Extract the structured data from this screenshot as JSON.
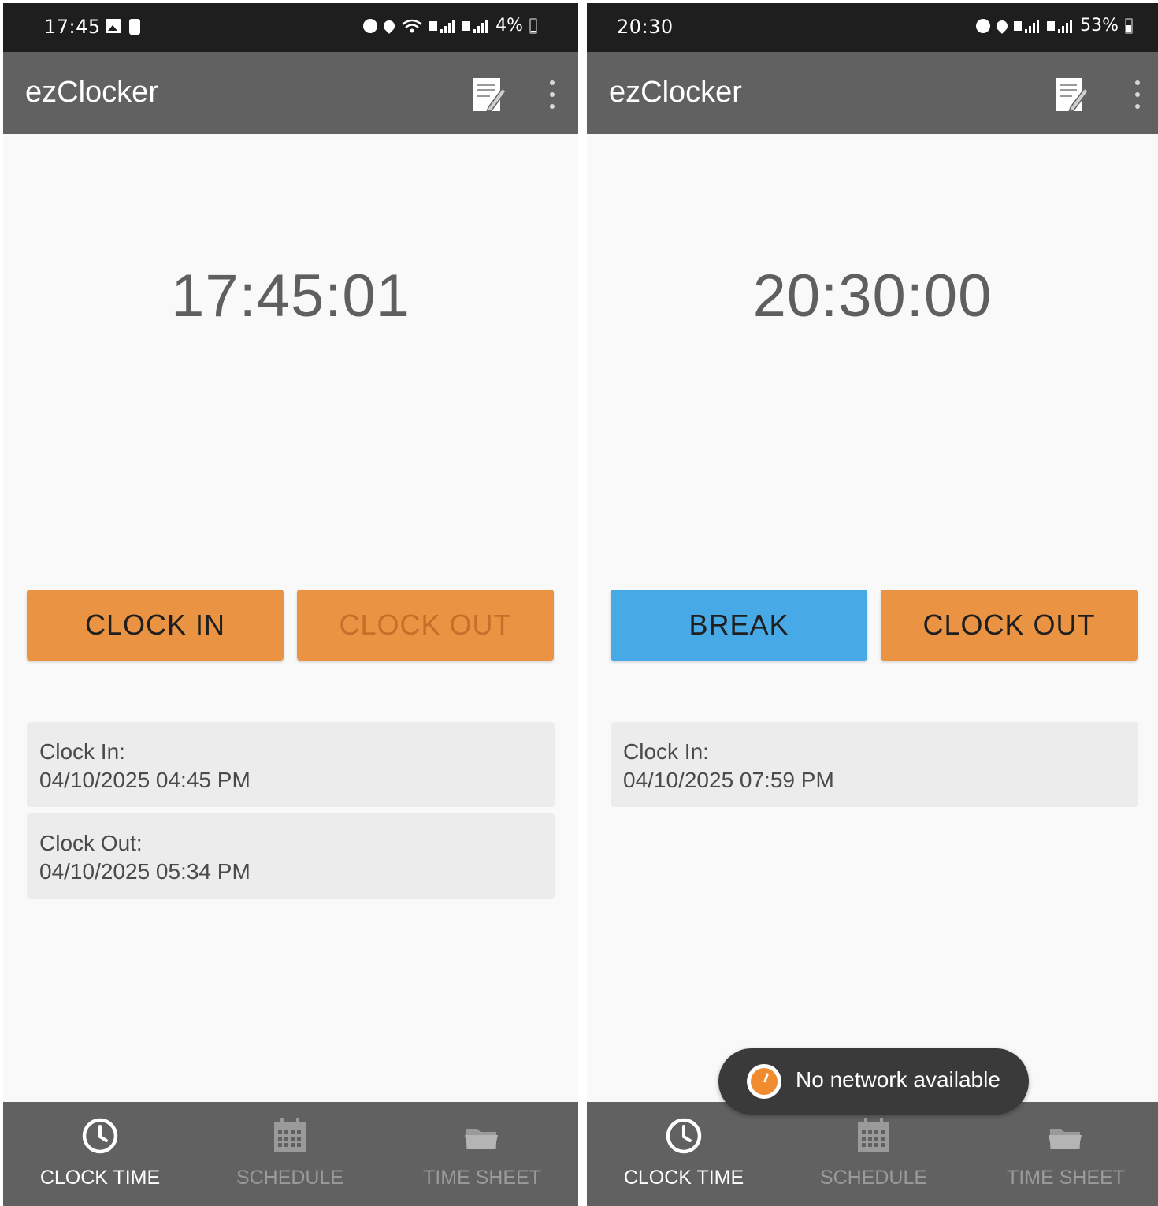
{
  "screens": [
    {
      "status_bar": {
        "time": "17:45",
        "battery": "4%"
      },
      "app_bar": {
        "title": "ezClocker"
      },
      "clock_display": "17:45:01",
      "buttons": [
        {
          "label": "CLOCK IN",
          "style": "orange",
          "enabled": true
        },
        {
          "label": "CLOCK OUT",
          "style": "orange",
          "enabled": false
        }
      ],
      "records": [
        {
          "label": "Clock In:",
          "value": "04/10/2025 04:45 PM"
        },
        {
          "label": "Clock Out:",
          "value": "04/10/2025 05:34 PM"
        }
      ],
      "bottom_nav": [
        {
          "label": "CLOCK TIME",
          "icon": "clock-icon",
          "active": true
        },
        {
          "label": "SCHEDULE",
          "icon": "calendar-icon",
          "active": false
        },
        {
          "label": "TIME SHEET",
          "icon": "folder-icon",
          "active": false
        }
      ]
    },
    {
      "status_bar": {
        "time": "20:30",
        "battery": "53%"
      },
      "app_bar": {
        "title": "ezClocker"
      },
      "clock_display": "20:30:00",
      "buttons": [
        {
          "label": "BREAK",
          "style": "blue",
          "enabled": true
        },
        {
          "label": "CLOCK OUT",
          "style": "orange",
          "enabled": true
        }
      ],
      "records": [
        {
          "label": "Clock In:",
          "value": "04/10/2025 07:59 PM"
        }
      ],
      "toast": {
        "text": "No network available"
      },
      "bottom_nav": [
        {
          "label": "CLOCK TIME",
          "icon": "clock-icon",
          "active": true
        },
        {
          "label": "SCHEDULE",
          "icon": "calendar-icon",
          "active": false
        },
        {
          "label": "TIME SHEET",
          "icon": "folder-icon",
          "active": false
        }
      ]
    }
  ],
  "colors": {
    "orange": "#ea9343",
    "blue": "#47aae6",
    "app_bar": "#616161",
    "status_bar": "#1e1e1e",
    "background": "#f9f9f9"
  }
}
